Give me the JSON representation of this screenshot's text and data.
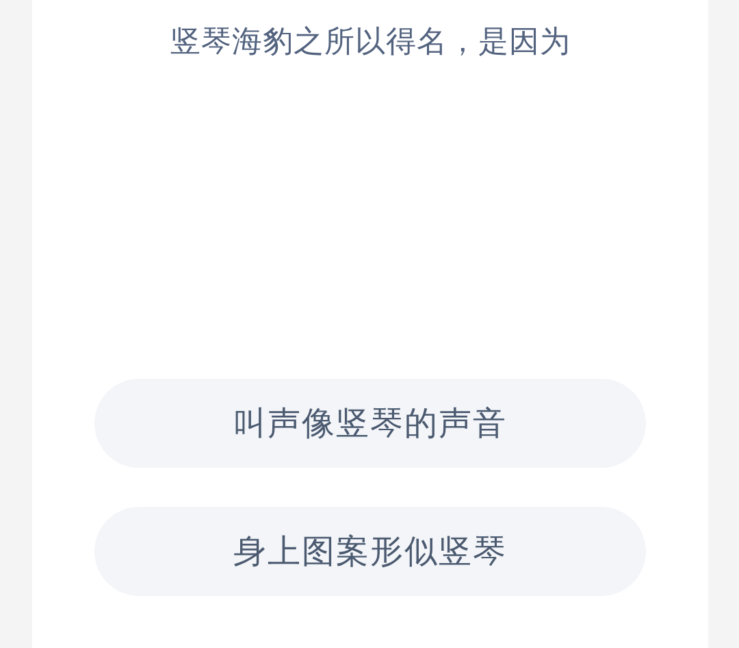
{
  "question": "竖琴海豹之所以得名，是因为",
  "options": [
    {
      "label": "叫声像竖琴的声音"
    },
    {
      "label": "身上图案形似竖琴"
    }
  ]
}
